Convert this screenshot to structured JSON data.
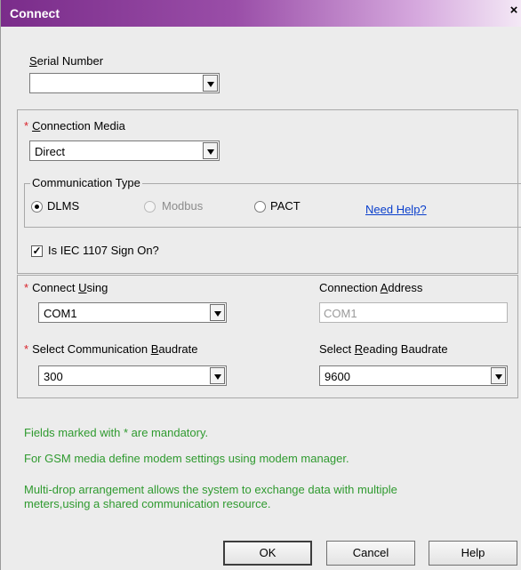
{
  "window": {
    "title": "Connect",
    "close_glyph": "×"
  },
  "serial": {
    "label_u": "S",
    "label_rest": "erial Number",
    "value": ""
  },
  "media": {
    "asterisk": "*",
    "label_u": "C",
    "label_rest": "onnection Media",
    "value": "Direct"
  },
  "comm_type": {
    "title": "Communication Type",
    "options": [
      "DLMS",
      "Modbus",
      "PACT"
    ],
    "selected": "DLMS",
    "disabled": [
      "Modbus"
    ],
    "help_link": "Need Help?"
  },
  "iec": {
    "label": "Is IEC 1107 Sign On?",
    "checked": true,
    "check_glyph": "✓"
  },
  "connect": {
    "asterisk": "*",
    "using_label_pre": "Connect ",
    "using_label_u": "U",
    "using_label_rest": "sing",
    "using_value": "COM1",
    "address_label_pre": "Connection ",
    "address_label_u": "A",
    "address_label_rest": "ddress",
    "address_value": "COM1",
    "baud_label_pre": "Select Communication ",
    "baud_label_u": "B",
    "baud_label_rest": "audrate",
    "baud_value": "300",
    "reading_label_pre": "Select ",
    "reading_label_u": "R",
    "reading_label_rest": "eading Baudrate",
    "reading_value": "9600"
  },
  "notes": [
    "Fields marked with * are mandatory.",
    "For GSM media define modem settings using modem manager.",
    "Multi-drop arrangement allows the system to exchange data with multiple meters,using a shared communication resource."
  ],
  "buttons": {
    "ok": "OK",
    "cancel": "Cancel",
    "help": "Help"
  },
  "colors": {
    "title_gradient_start": "#7a2c8a",
    "required": "#d9222a",
    "note_green": "#2f9a2f",
    "link": "#0a3fcc"
  }
}
